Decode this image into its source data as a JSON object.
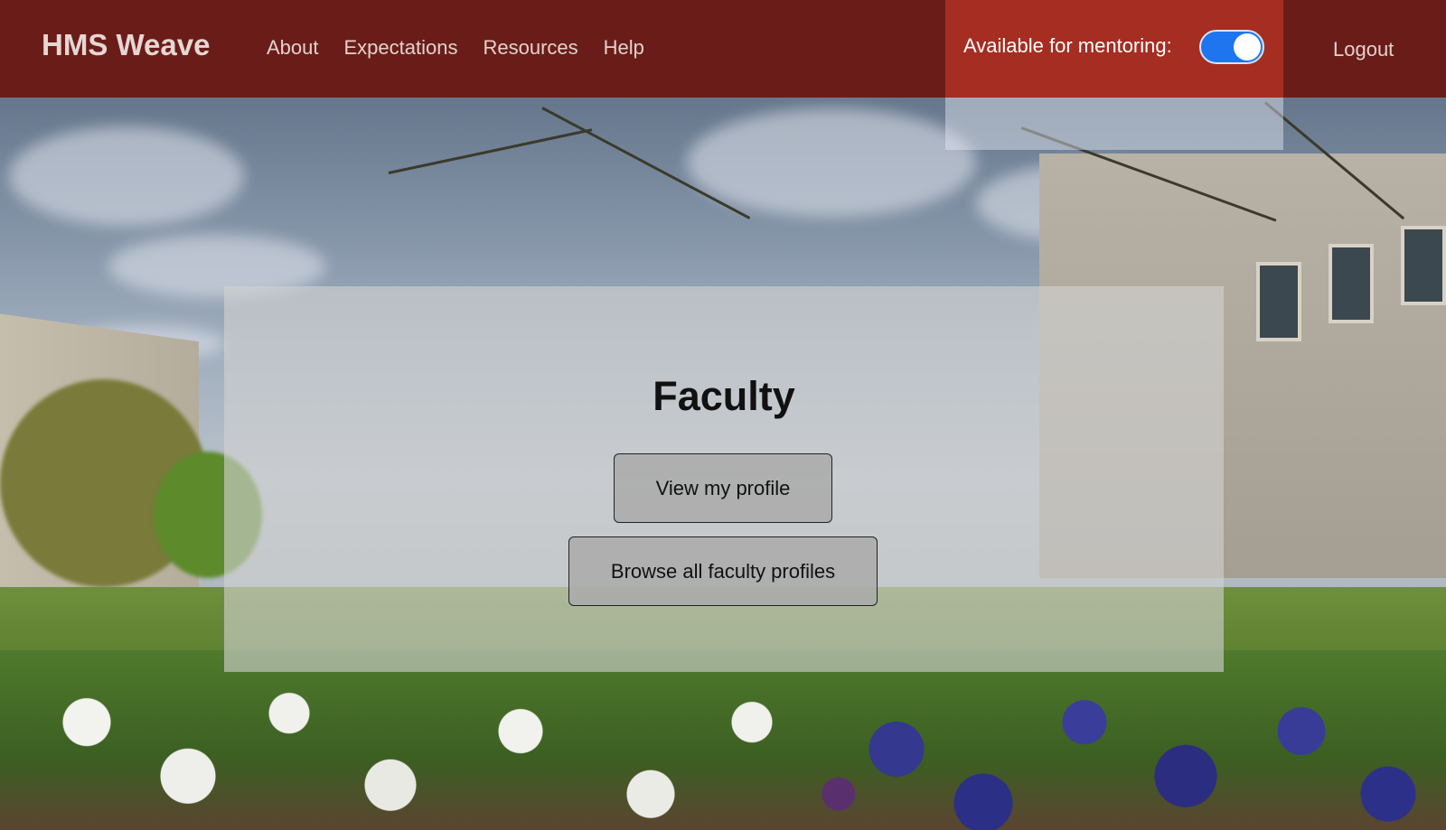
{
  "navbar": {
    "brand": "HMS Weave",
    "links": [
      {
        "label": "About"
      },
      {
        "label": "Expectations"
      },
      {
        "label": "Resources"
      },
      {
        "label": "Help"
      }
    ],
    "mentoring": {
      "label": "Available for mentoring:",
      "enabled": true
    },
    "logout_label": "Logout"
  },
  "main": {
    "title": "Faculty",
    "view_profile_label": "View my profile",
    "browse_label": "Browse all faculty profiles"
  },
  "colors": {
    "navbar_bg": "#6a1d18",
    "mentor_box_bg": "#a52d22",
    "toggle_on": "#1f75f0"
  }
}
